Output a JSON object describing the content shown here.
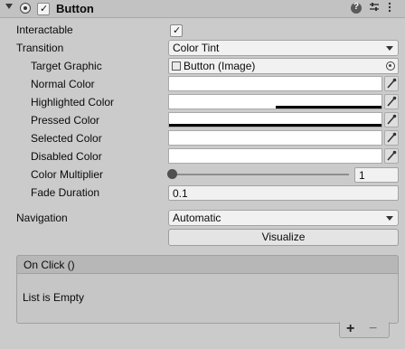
{
  "component": {
    "title": "Button",
    "enabled": true
  },
  "properties": {
    "interactable_label": "Interactable",
    "interactable_checked": true,
    "transition_label": "Transition",
    "transition_value": "Color Tint",
    "target_graphic_label": "Target Graphic",
    "target_graphic_value": "Button (Image)",
    "normal_color_label": "Normal Color",
    "normal_color": "#FFFFFF",
    "highlighted_color_label": "Highlighted Color",
    "highlighted_color": "#F5F5F5",
    "pressed_color_label": "Pressed Color",
    "pressed_color": "#C8C8C8",
    "selected_color_label": "Selected Color",
    "selected_color": "#F5F5F5",
    "disabled_color_label": "Disabled Color",
    "disabled_color": "#C8C8C8",
    "color_multiplier_label": "Color Multiplier",
    "color_multiplier_value": "1",
    "fade_duration_label": "Fade Duration",
    "fade_duration_value": "0.1",
    "navigation_label": "Navigation",
    "navigation_value": "Automatic",
    "visualize_label": "Visualize"
  },
  "on_click": {
    "header": "On Click ()",
    "empty_text": "List is Empty",
    "add_label": "+",
    "remove_label": "−"
  },
  "icons": [
    "foldout-arrow-icon",
    "component-icon",
    "help-icon",
    "presets-icon",
    "more-icon",
    "object-picker-icon",
    "eyedropper-icon",
    "checkmark-icon"
  ]
}
